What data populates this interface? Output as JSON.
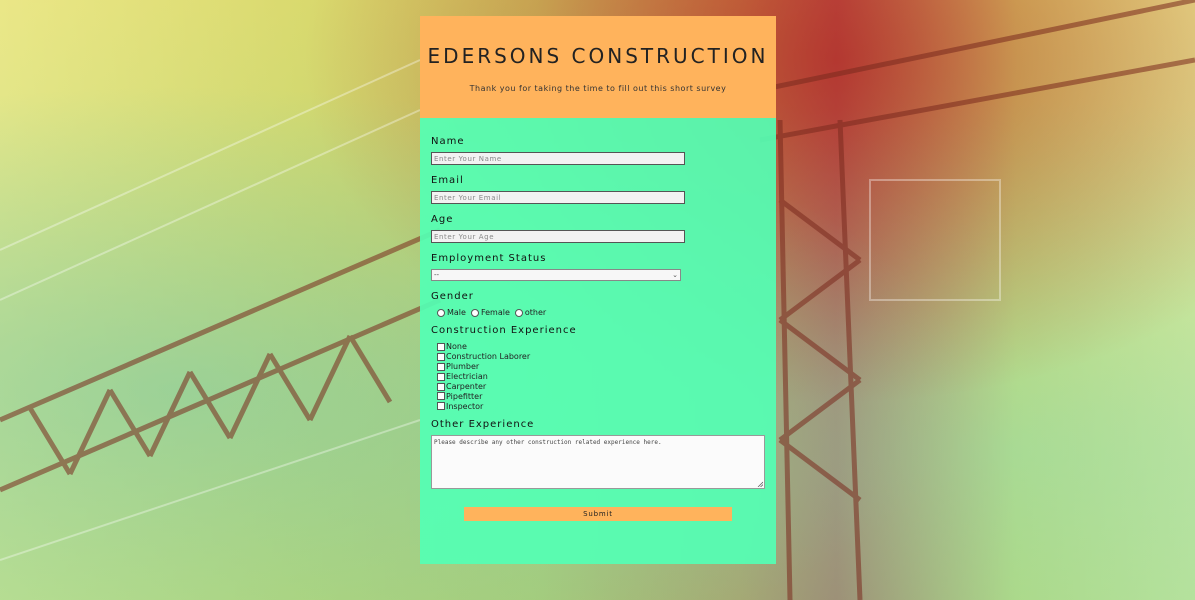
{
  "header": {
    "title": "EDERSONS CONSTRUCTION",
    "subtitle": "Thank you for taking the time to fill out this short survey"
  },
  "form": {
    "name": {
      "label": "Name",
      "placeholder": "Enter Your Name",
      "value": ""
    },
    "email": {
      "label": "Email",
      "placeholder": "Enter Your Email",
      "value": ""
    },
    "age": {
      "label": "Age",
      "placeholder": "Enter Your Age",
      "value": ""
    },
    "employment": {
      "label": "Employment Status",
      "selected": "--"
    },
    "gender": {
      "label": "Gender",
      "options": [
        "Male",
        "Female",
        "other"
      ]
    },
    "experience": {
      "label": "Construction Experience",
      "options": [
        "None",
        "Construction Laborer",
        "Plumber",
        "Electrician",
        "Carpenter",
        "Pipefitter",
        "Inspector"
      ]
    },
    "other": {
      "label": "Other Experience",
      "placeholder": "Please describe any other construction related experience here."
    },
    "submit_label": "Submit"
  },
  "colors": {
    "header_bg": "#ffb35c",
    "form_bg": "#54ffb4",
    "button_bg": "#ffb35c"
  }
}
